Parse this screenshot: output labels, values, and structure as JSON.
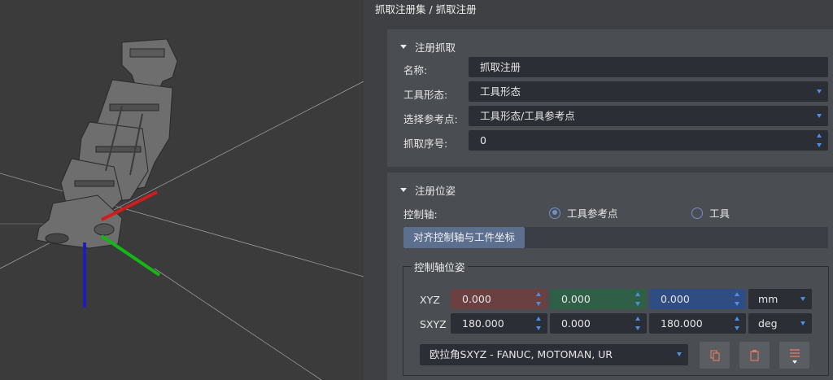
{
  "breadcrumb": "抓取注册集 / 抓取注册",
  "register_grasp": {
    "header": "注册抓取",
    "name": {
      "label": "名称:",
      "value": "抓取注册"
    },
    "tool_form": {
      "label": "工具形态:",
      "value": "工具形态"
    },
    "ref_point": {
      "label": "选择参考点:",
      "value": "工具形态/工具参考点"
    },
    "grasp_index": {
      "label": "抓取序号:",
      "value": "0"
    }
  },
  "register_pose": {
    "header": "注册位姿",
    "control_axis": {
      "label": "控制轴:",
      "options": [
        {
          "label": "工具参考点",
          "selected": true
        },
        {
          "label": "工具",
          "selected": false
        }
      ]
    },
    "align_button": "对齐控制轴与工件坐标",
    "pose_group": {
      "legend": "控制轴位姿",
      "xyz": {
        "label": "XYZ",
        "x": "0.000",
        "y": "0.000",
        "z": "0.000",
        "unit": "mm"
      },
      "sxyz": {
        "label": "SXYZ",
        "a": "180.000",
        "b": "0.000",
        "c": "180.000",
        "unit": "deg"
      },
      "euler_convention": "欧拉角SXYZ - FANUC, MOTOMAN, UR",
      "buttons": [
        "copy-icon",
        "paste-icon",
        "menu-icon"
      ]
    }
  },
  "colors": {
    "x_axis": "#d01c1c",
    "y_axis": "#14b814",
    "z_axis": "#1f1fb8",
    "icon_accent": "#e07a5f",
    "spin_arrow": "#4c8fe6"
  }
}
